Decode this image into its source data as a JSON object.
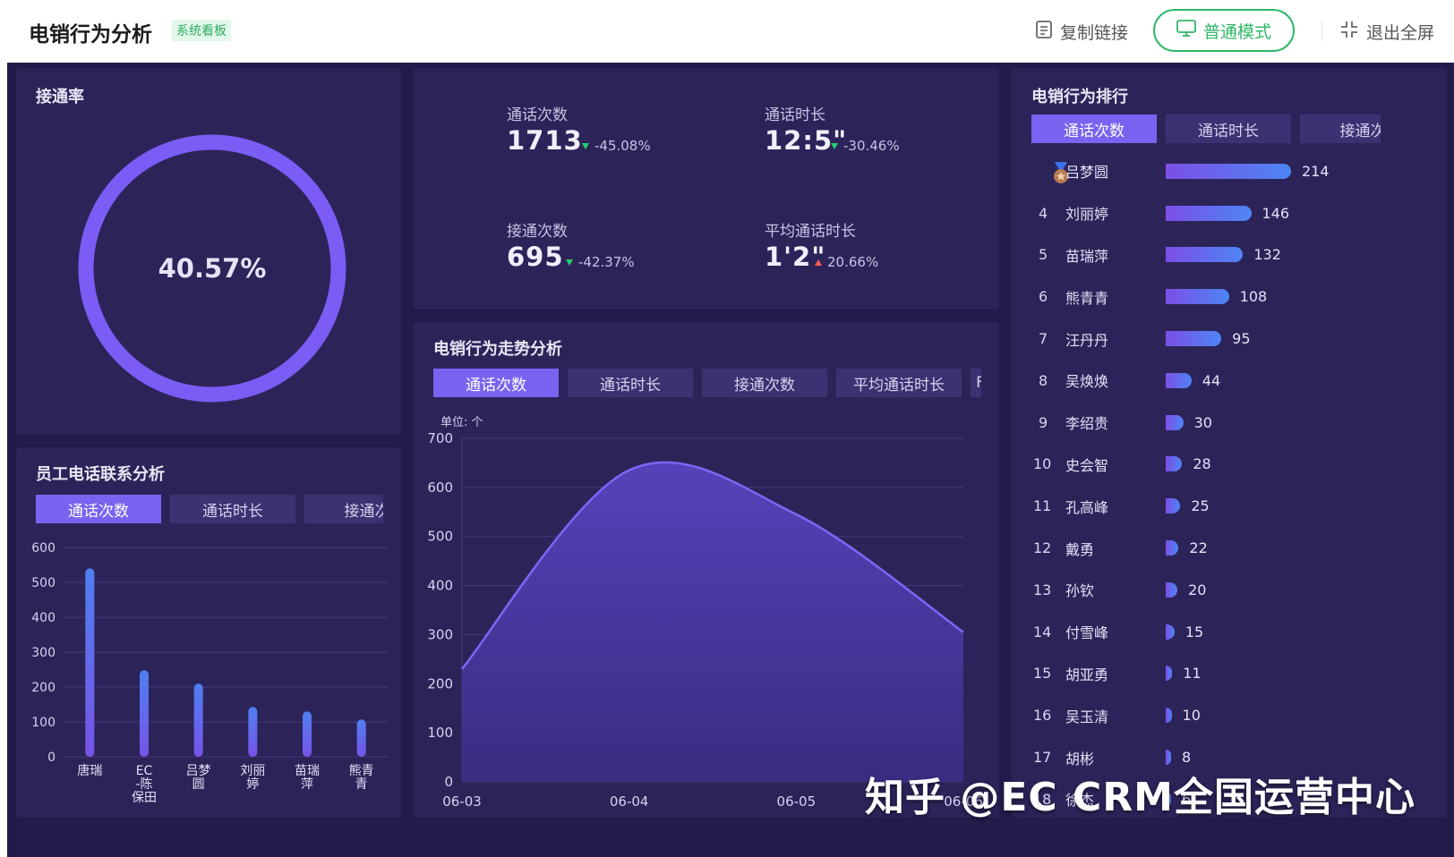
{
  "header": {
    "title": "电销行为分析",
    "badge": "系统看板",
    "copy_link": "复制链接",
    "mode_button": "普通模式",
    "exit_fullscreen": "退出全屏"
  },
  "connect_rate": {
    "title": "接通率",
    "value_text": "40.57%",
    "value": 40.57
  },
  "stats": [
    {
      "label": "通话次数",
      "value": "1713",
      "change": "-45.08%",
      "direction": "down"
    },
    {
      "label": "通话时长",
      "value": "12:5\"",
      "change": "-30.46%",
      "direction": "down"
    },
    {
      "label": "接通次数",
      "value": "695",
      "change": "-42.37%",
      "direction": "down"
    },
    {
      "label": "平均通话时长",
      "value": "1'2\"",
      "change": "20.66%",
      "direction": "up"
    }
  ],
  "employee_calls": {
    "title": "员工电话联系分析",
    "tabs": [
      "通话次数",
      "通话时长",
      "接通次"
    ],
    "chart_data": {
      "type": "bar",
      "categories": [
        "唐瑞",
        "EC-陈保田",
        "吕梦圆",
        "刘丽婷",
        "苗瑞萍",
        "熊青青"
      ],
      "category_lines": [
        [
          "唐瑞"
        ],
        [
          "EC",
          "-陈",
          "保田"
        ],
        [
          "吕梦",
          "圆"
        ],
        [
          "刘丽",
          "婷"
        ],
        [
          "苗瑞",
          "萍"
        ],
        [
          "熊青",
          "青"
        ]
      ],
      "values": [
        540,
        248,
        210,
        143,
        130,
        107
      ],
      "yticks": [
        0,
        100,
        200,
        300,
        400,
        500,
        600
      ],
      "ylim": [
        0,
        600
      ]
    }
  },
  "trend": {
    "title": "电销行为走势分析",
    "tabs": [
      "通话次数",
      "通话时长",
      "接通次数",
      "平均通话时长",
      "F"
    ],
    "unit": "单位: 个",
    "chart_data": {
      "type": "area",
      "x": [
        "06-03",
        "06-04",
        "06-05",
        "06-06"
      ],
      "values": [
        230,
        635,
        545,
        305
      ],
      "yticks": [
        0,
        100,
        200,
        300,
        400,
        500,
        600,
        700
      ],
      "ylim": [
        0,
        700
      ]
    }
  },
  "ranking": {
    "title": "电销行为排行",
    "tabs": [
      "通话次数",
      "通话时长",
      "接通次"
    ],
    "rows": [
      {
        "rank": "",
        "medal": true,
        "name": "吕梦圆",
        "value": 214
      },
      {
        "rank": "4",
        "name": "刘丽婷",
        "value": 146
      },
      {
        "rank": "5",
        "name": "苗瑞萍",
        "value": 132
      },
      {
        "rank": "6",
        "name": "熊青青",
        "value": 108
      },
      {
        "rank": "7",
        "name": "汪丹丹",
        "value": 95
      },
      {
        "rank": "8",
        "name": "吴焕焕",
        "value": 44
      },
      {
        "rank": "9",
        "name": "李绍贵",
        "value": 30
      },
      {
        "rank": "10",
        "name": "史会智",
        "value": 28
      },
      {
        "rank": "11",
        "name": "孔高峰",
        "value": 25
      },
      {
        "rank": "12",
        "name": "戴勇",
        "value": 22
      },
      {
        "rank": "13",
        "name": "孙钦",
        "value": 20
      },
      {
        "rank": "14",
        "name": "付雪峰",
        "value": 15
      },
      {
        "rank": "15",
        "name": "胡亚勇",
        "value": 11
      },
      {
        "rank": "16",
        "name": "吴玉清",
        "value": 10
      },
      {
        "rank": "17",
        "name": "胡彬",
        "value": 8
      },
      {
        "rank": "18",
        "name": "徐杰",
        "value": 6
      }
    ]
  },
  "watermark": "知乎 @EC CRM全国运营中心",
  "colors": {
    "background": "#241b4b",
    "panel": "#2c2459",
    "accent": "#7a63f0",
    "ring": "#7b5cf5",
    "green": "#2fb767",
    "down": "#1fd16a",
    "up": "#ff5b4e"
  }
}
